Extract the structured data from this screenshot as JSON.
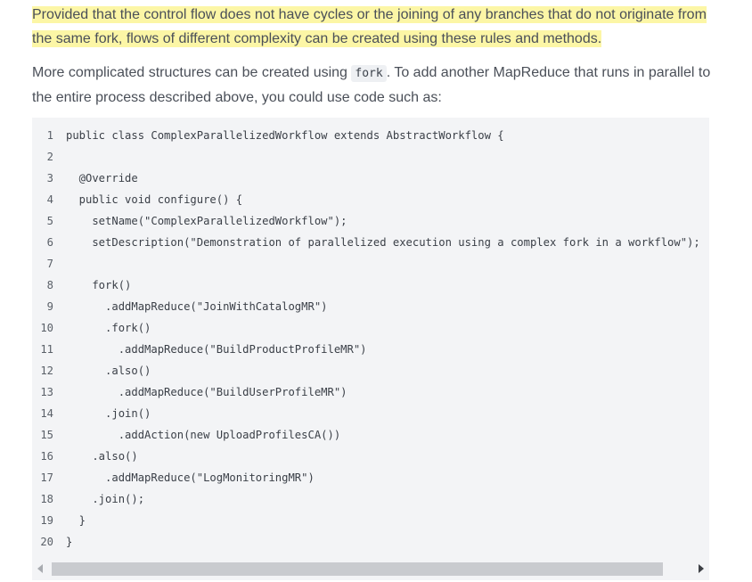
{
  "paragraph1": {
    "text": "Provided that the control flow does not have cycles or the joining of any branches that do not originate from the same fork, flows of different complexity can be created using these rules and methods."
  },
  "paragraph2": {
    "before": "More complicated structures can be created using ",
    "code": "fork",
    "after": ". To add another MapReduce that runs in parallel to the entire process described above, you could use code such as:"
  },
  "code_lines": [
    {
      "n": "1",
      "t": "public class ComplexParallelizedWorkflow extends AbstractWorkflow {"
    },
    {
      "n": "2",
      "t": ""
    },
    {
      "n": "3",
      "t": "  @Override"
    },
    {
      "n": "4",
      "t": "  public void configure() {"
    },
    {
      "n": "5",
      "t": "    setName(\"ComplexParallelizedWorkflow\");"
    },
    {
      "n": "6",
      "t": "    setDescription(\"Demonstration of parallelized execution using a complex fork in a workflow\");"
    },
    {
      "n": "7",
      "t": ""
    },
    {
      "n": "8",
      "t": "    fork()"
    },
    {
      "n": "9",
      "t": "      .addMapReduce(\"JoinWithCatalogMR\")"
    },
    {
      "n": "10",
      "t": "      .fork()"
    },
    {
      "n": "11",
      "t": "        .addMapReduce(\"BuildProductProfileMR\")"
    },
    {
      "n": "12",
      "t": "      .also()"
    },
    {
      "n": "13",
      "t": "        .addMapReduce(\"BuildUserProfileMR\")"
    },
    {
      "n": "14",
      "t": "      .join()"
    },
    {
      "n": "15",
      "t": "        .addAction(new UploadProfilesCA())"
    },
    {
      "n": "16",
      "t": "    .also()"
    },
    {
      "n": "17",
      "t": "      .addMapReduce(\"LogMonitoringMR\")"
    },
    {
      "n": "18",
      "t": "    .join();"
    },
    {
      "n": "19",
      "t": "  }"
    },
    {
      "n": "20",
      "t": "}"
    }
  ],
  "icons": {
    "scroll_left": "arrow-left-icon",
    "scroll_right": "arrow-right-icon"
  },
  "colors": {
    "highlight": "#fcf6a6",
    "code_background": "#f3f4f6",
    "inline_code_background": "#eef0f3"
  }
}
